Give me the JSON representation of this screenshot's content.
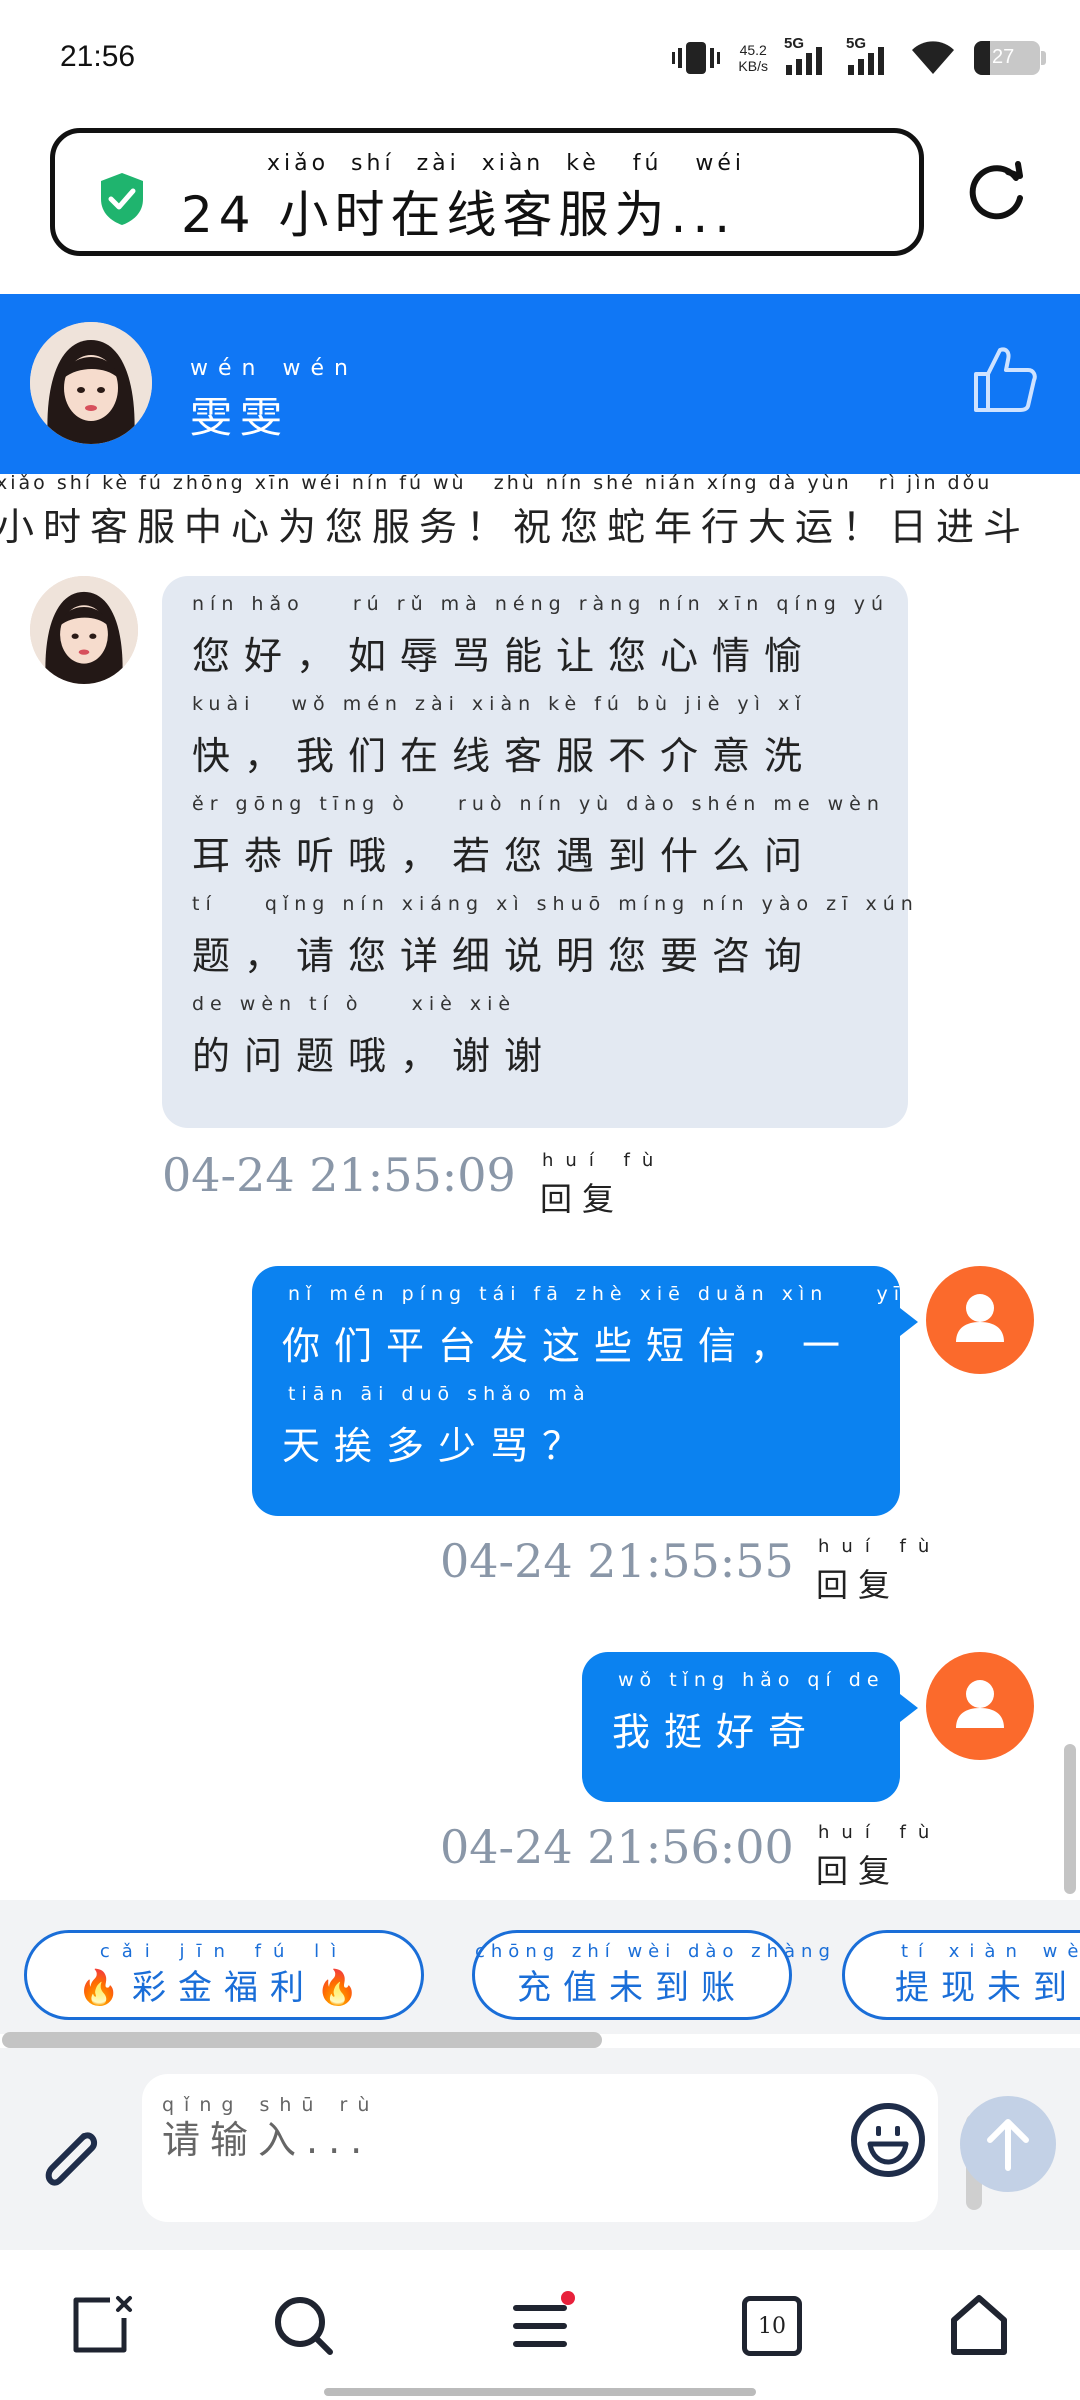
{
  "status_bar": {
    "time": "21:56",
    "net_speed_value": "45.2",
    "net_speed_unit": "KB/s",
    "signal1_label": "5G",
    "signal2_label": "5G",
    "battery": "27"
  },
  "url_bar": {
    "title": "24 小时在线客服为...",
    "pinyin": "xiǎo  shí  zài  xiàn  kè   fú   wéi"
  },
  "chat_header": {
    "agent_name": "雯雯",
    "agent_pinyin": "wén wén"
  },
  "marquee": {
    "pinyin": "xiǎo shí kè fú zhōng xīn wéi nín fú wù   zhù nín shé nián xíng dà yùn   rì jìn dǒu",
    "text": "小时客服中心为您服务！祝您蛇年行大运！日进斗"
  },
  "messages": [
    {
      "side": "in",
      "lines": [
        "您好，如辱骂能让您心情愉",
        "快，我们在线客服不介意洗",
        "耳恭听哦，若您遇到什么问",
        "题，请您详细说明您要咨询",
        "的问题哦，谢谢"
      ],
      "pinyin": [
        "nín hǎo    rú rǔ mà néng ràng nín xīn qíng yú",
        "kuài   wǒ mén zài xiàn kè fú bù jiè yì xǐ",
        "ěr gōng tīng ò    ruò nín yù dào shén me wèn",
        "tí    qǐng nín xiáng xì shuō míng nín yào zī xún",
        "de wèn tí ò    xiè xiè"
      ],
      "time": "04-24 21:55:09",
      "reply": "回复",
      "reply_pinyin": "huí fù"
    },
    {
      "side": "out",
      "lines": [
        "你们平台发这些短信，一",
        "天挨多少骂？"
      ],
      "pinyin": [
        "nǐ mén píng tái fā zhè xiē duǎn xìn    yī",
        "tiān āi duō shǎo mà"
      ],
      "time": "04-24 21:55:55",
      "reply": "回复",
      "reply_pinyin": "huí fù"
    },
    {
      "side": "out",
      "lines": [
        "我挺好奇的"
      ],
      "pinyin": [
        "wǒ tǐng hǎo qí de"
      ],
      "time": "04-24 21:56:00",
      "reply": "回复",
      "reply_pinyin": "huí fù"
    }
  ],
  "quick_replies": [
    {
      "label": "🔥彩金福利🔥",
      "pinyin": "cǎi jīn fú lì"
    },
    {
      "label": "充值未到账",
      "pinyin": "chōng zhí wèi dào zhàng"
    },
    {
      "label": "提现未到",
      "pinyin": "tí xiàn wèi dào z"
    }
  ],
  "input": {
    "placeholder": "请输入...",
    "placeholder_pinyin": "qǐng shū rù"
  },
  "nav": {
    "tabs_count": "10"
  },
  "colors": {
    "header_blue": "#1077f5",
    "bubble_out": "#0b82f0",
    "bubble_in": "#e3e9f2",
    "user_avatar": "#fb6a2c",
    "shield_green": "#1fb46e"
  }
}
